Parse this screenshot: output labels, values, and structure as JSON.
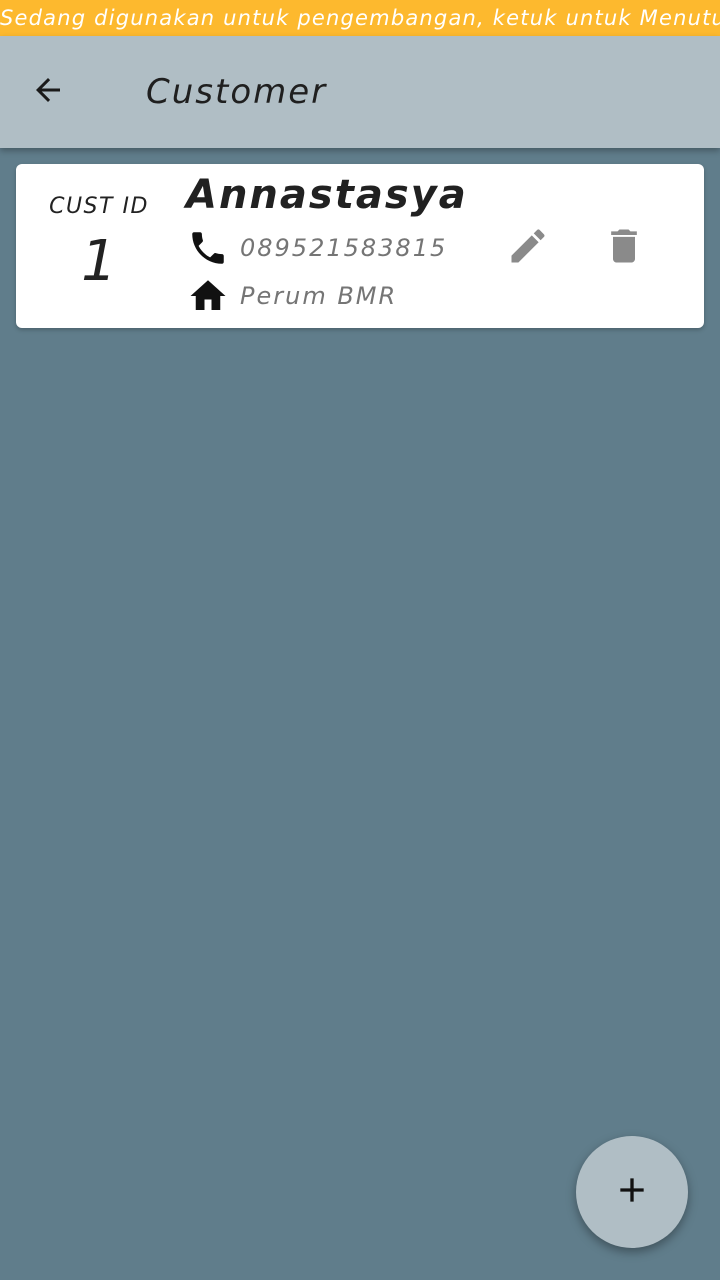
{
  "dev_banner": {
    "text": "Sedang digunakan untuk pengembangan, ketuk untuk Menutup",
    "color": "#fdb92e"
  },
  "app_bar": {
    "title": "Customer",
    "back_icon": "arrow-back-icon",
    "background": "#b0bec5"
  },
  "page": {
    "background": "#607d8b"
  },
  "customers": [
    {
      "id_label": "CUST ID",
      "id": "1",
      "name": "Annastasya",
      "phone": "089521583815",
      "phone_icon": "phone-icon",
      "address": "Perum BMR",
      "address_icon": "home-icon",
      "edit_icon": "pencil-icon",
      "delete_icon": "trash-icon"
    }
  ],
  "fab": {
    "icon": "plus-icon"
  }
}
